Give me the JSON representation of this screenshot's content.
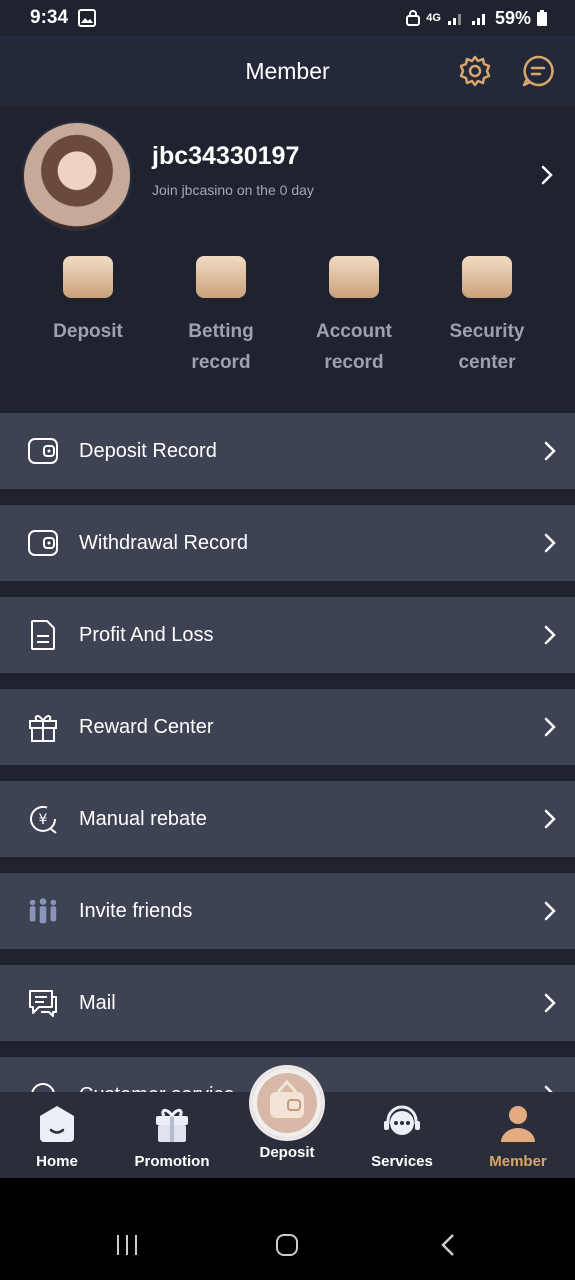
{
  "status": {
    "time": "9:34",
    "battery": "59%",
    "network": "4G"
  },
  "header": {
    "title": "Member"
  },
  "profile": {
    "username": "jbc34330197",
    "join_text": "Join jbcasino on the 0 day"
  },
  "quick_actions": [
    {
      "line1": "Deposit",
      "line2": ""
    },
    {
      "line1": "Betting",
      "line2": "record"
    },
    {
      "line1": "Account",
      "line2": "record"
    },
    {
      "line1": "Security",
      "line2": "center"
    }
  ],
  "menu": [
    {
      "label": "Deposit Record",
      "icon": "wallet-icon"
    },
    {
      "label": "Withdrawal Record",
      "icon": "wallet-icon"
    },
    {
      "label": "Profit And Loss",
      "icon": "document-icon"
    },
    {
      "label": "Reward Center",
      "icon": "gift-icon"
    },
    {
      "label": "Manual rebate",
      "icon": "yen-refresh-icon"
    },
    {
      "label": "Invite friends",
      "icon": "people-icon"
    },
    {
      "label": "Mail",
      "icon": "chat-icon"
    },
    {
      "label": "Customer service",
      "icon": "headset-icon"
    }
  ],
  "tabs": [
    {
      "label": "Home"
    },
    {
      "label": "Promotion"
    },
    {
      "label": "Deposit"
    },
    {
      "label": "Services"
    },
    {
      "label": "Member"
    }
  ],
  "colors": {
    "accent": "#d9a76a",
    "row": "#3e4354",
    "bg": "#1f2330"
  }
}
